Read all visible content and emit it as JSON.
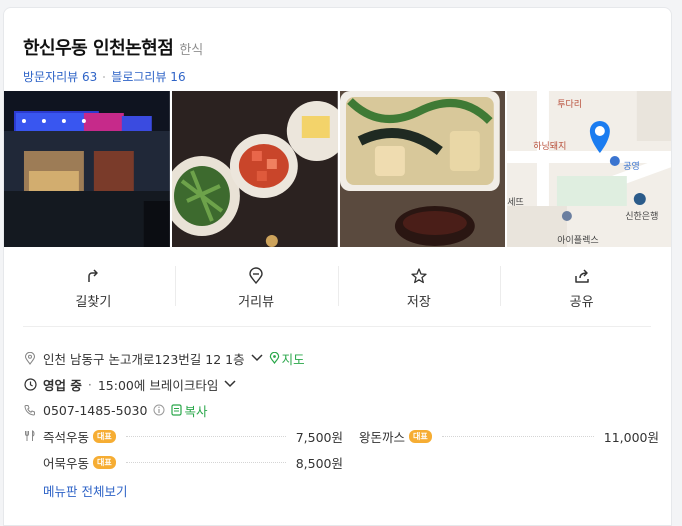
{
  "place": {
    "name": "한신우동 인천논현점",
    "category": "한식",
    "visitor_reviews": "방문자리뷰 63",
    "blog_reviews": "블로그리뷰 16"
  },
  "photos": [
    {
      "icon": "restaurant-exterior-photo"
    },
    {
      "icon": "side-dishes-photo"
    },
    {
      "icon": "udon-bowl-photo"
    },
    {
      "icon": "map-thumbnail",
      "labels": [
        "투다리",
        "하닝돼지",
        "공영",
        "신한은행",
        "아이플렉스",
        "세뜨"
      ]
    }
  ],
  "actions": [
    {
      "label": "길찾기",
      "icon": "directions-icon"
    },
    {
      "label": "거리뷰",
      "icon": "street-view-icon"
    },
    {
      "label": "저장",
      "icon": "star-icon"
    },
    {
      "label": "공유",
      "icon": "share-icon"
    }
  ],
  "info": {
    "address": "인천 남동구 논고개로123번길 12 1층",
    "map_link": "지도",
    "status": "영업 중",
    "break_time": "15:00에 브레이크타임",
    "phone": "0507-1485-5030",
    "copy_link": "복사"
  },
  "menu": {
    "badge": "대표",
    "items": [
      {
        "name": "즉석우동",
        "price": "7,500원"
      },
      {
        "name": "왕돈까스",
        "price": "11,000원"
      },
      {
        "name": "어묵우동",
        "price": "8,500원"
      }
    ],
    "view_all": "메뉴판 전체보기"
  }
}
